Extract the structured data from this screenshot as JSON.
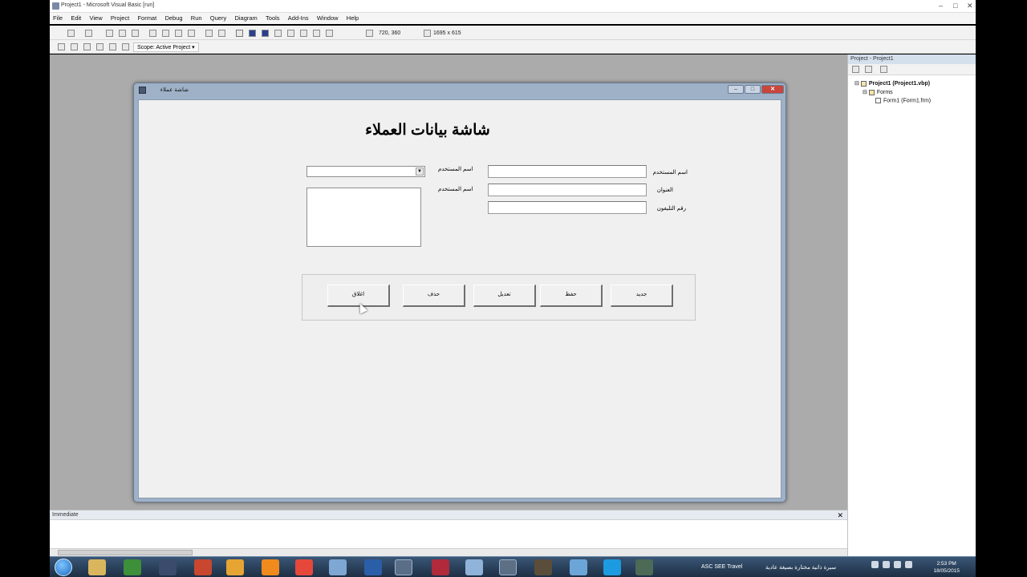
{
  "window": {
    "title": "Project1 - Microsoft Visual Basic [run]"
  },
  "menu": [
    "File",
    "Edit",
    "View",
    "Project",
    "Format",
    "Debug",
    "Run",
    "Query",
    "Diagram",
    "Tools",
    "Add-Ins",
    "Window",
    "Help"
  ],
  "toolbar": {
    "position_readout": "720, 360",
    "size_readout": "1695 x 615",
    "scope_label": "Scope: Active Project"
  },
  "form": {
    "title": "شاشة عملاء",
    "heading": "شاشة بيانات العملاء",
    "labels": {
      "user_name_1": "اسم المستخدم",
      "address": "العنوان",
      "phone": "رقم التليفون",
      "user_name_left_1": "اسم المستخدم",
      "user_name_left_2": "اسم المستخدم"
    },
    "buttons": {
      "new": "جديد",
      "save": "حفظ",
      "edit": "تعديل",
      "delete": "حذف",
      "close": "اغلاق"
    }
  },
  "project_explorer": {
    "title": "Project - Project1",
    "tree": {
      "project": "Project1 (Project1.vbp)",
      "forms_folder": "Forms",
      "form_item": "Form1 (Form1.frm)"
    }
  },
  "immediate": {
    "title": "Immediate"
  },
  "taskbar": {
    "task_text_1": "ASC SEE Travel",
    "task_text_2": "سيرة ذاتية مختارة بصيغة عادية",
    "time": "2:53 PM",
    "date": "18/05/2015"
  },
  "colors": {
    "form_border": "#9fb1c7",
    "workspace": "#ababab",
    "taskbar": "#1d2f44"
  }
}
